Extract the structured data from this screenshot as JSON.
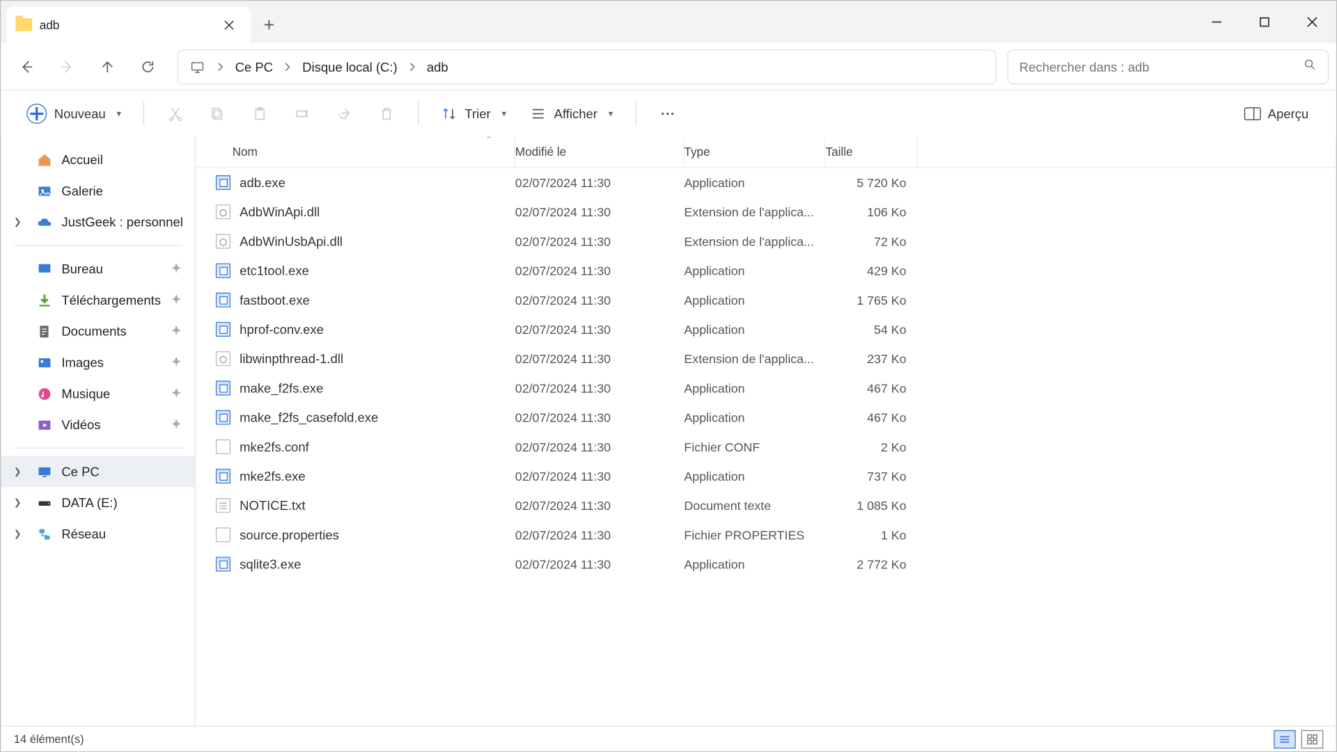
{
  "tab": {
    "title": "adb"
  },
  "breadcrumbs": {
    "pc": "Ce PC",
    "drive": "Disque local (C:)",
    "folder": "adb"
  },
  "search": {
    "placeholder": "Rechercher dans : adb"
  },
  "toolbar": {
    "new": "Nouveau",
    "sort": "Trier",
    "view": "Afficher",
    "preview": "Aperçu"
  },
  "sidebar": {
    "home": "Accueil",
    "gallery": "Galerie",
    "personal": "JustGeek : personnel",
    "desktop": "Bureau",
    "downloads": "Téléchargements",
    "documents": "Documents",
    "pictures": "Images",
    "music": "Musique",
    "videos": "Vidéos",
    "thispc": "Ce PC",
    "data": "DATA (E:)",
    "network": "Réseau"
  },
  "columns": {
    "name": "Nom",
    "modified": "Modifié le",
    "type": "Type",
    "size": "Taille"
  },
  "files": [
    {
      "name": "adb.exe",
      "modified": "02/07/2024 11:30",
      "type": "Application",
      "size": "5 720 Ko",
      "icon": "exe"
    },
    {
      "name": "AdbWinApi.dll",
      "modified": "02/07/2024 11:30",
      "type": "Extension de l'applica...",
      "size": "106 Ko",
      "icon": "dll"
    },
    {
      "name": "AdbWinUsbApi.dll",
      "modified": "02/07/2024 11:30",
      "type": "Extension de l'applica...",
      "size": "72 Ko",
      "icon": "dll"
    },
    {
      "name": "etc1tool.exe",
      "modified": "02/07/2024 11:30",
      "type": "Application",
      "size": "429 Ko",
      "icon": "exe"
    },
    {
      "name": "fastboot.exe",
      "modified": "02/07/2024 11:30",
      "type": "Application",
      "size": "1 765 Ko",
      "icon": "exe"
    },
    {
      "name": "hprof-conv.exe",
      "modified": "02/07/2024 11:30",
      "type": "Application",
      "size": "54 Ko",
      "icon": "exe"
    },
    {
      "name": "libwinpthread-1.dll",
      "modified": "02/07/2024 11:30",
      "type": "Extension de l'applica...",
      "size": "237 Ko",
      "icon": "dll"
    },
    {
      "name": "make_f2fs.exe",
      "modified": "02/07/2024 11:30",
      "type": "Application",
      "size": "467 Ko",
      "icon": "exe"
    },
    {
      "name": "make_f2fs_casefold.exe",
      "modified": "02/07/2024 11:30",
      "type": "Application",
      "size": "467 Ko",
      "icon": "exe"
    },
    {
      "name": "mke2fs.conf",
      "modified": "02/07/2024 11:30",
      "type": "Fichier CONF",
      "size": "2 Ko",
      "icon": "file"
    },
    {
      "name": "mke2fs.exe",
      "modified": "02/07/2024 11:30",
      "type": "Application",
      "size": "737 Ko",
      "icon": "exe"
    },
    {
      "name": "NOTICE.txt",
      "modified": "02/07/2024 11:30",
      "type": "Document texte",
      "size": "1 085 Ko",
      "icon": "txt"
    },
    {
      "name": "source.properties",
      "modified": "02/07/2024 11:30",
      "type": "Fichier PROPERTIES",
      "size": "1 Ko",
      "icon": "file"
    },
    {
      "name": "sqlite3.exe",
      "modified": "02/07/2024 11:30",
      "type": "Application",
      "size": "2 772 Ko",
      "icon": "exe"
    }
  ],
  "status": {
    "count": "14 élément(s)"
  }
}
